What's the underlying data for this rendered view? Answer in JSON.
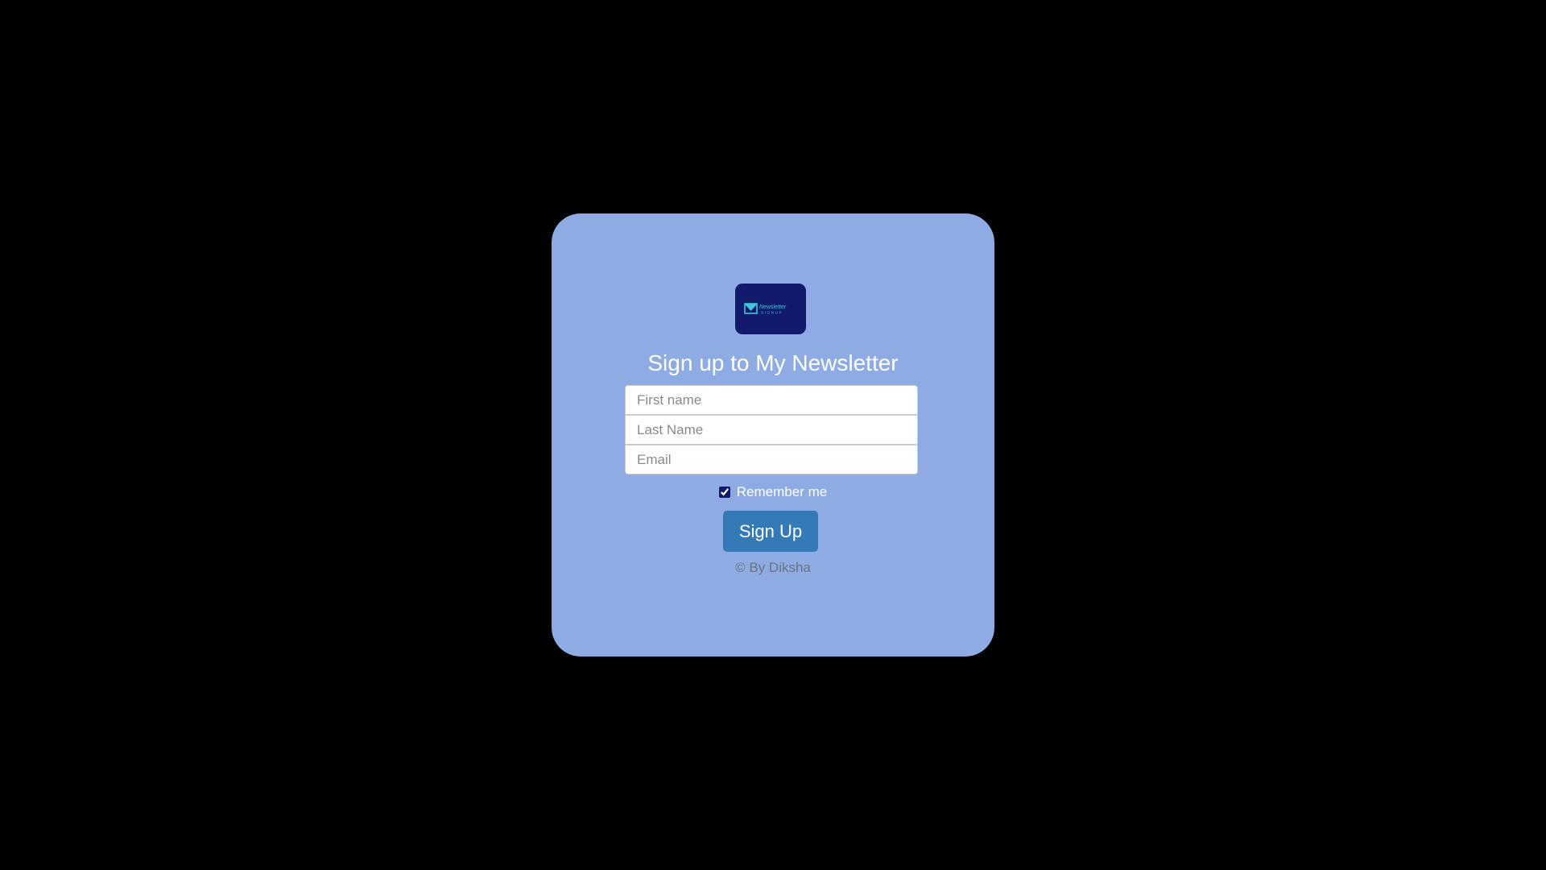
{
  "logo": {
    "icon": "newsletter-envelope-icon",
    "text_top": "Newsletter",
    "text_bottom": "SIGNUP"
  },
  "title": "Sign up to My Newsletter",
  "form": {
    "first_name_placeholder": "First name",
    "last_name_placeholder": "Last Name",
    "email_placeholder": "Email",
    "remember_label": "Remember me",
    "remember_checked": true,
    "submit_label": "Sign Up"
  },
  "footer": "© By Diksha",
  "colors": {
    "background": "#000000",
    "card": "#8eabe3",
    "logo_bg": "#111a6b",
    "button": "#337ab7",
    "footer_text": "#6c757d"
  }
}
